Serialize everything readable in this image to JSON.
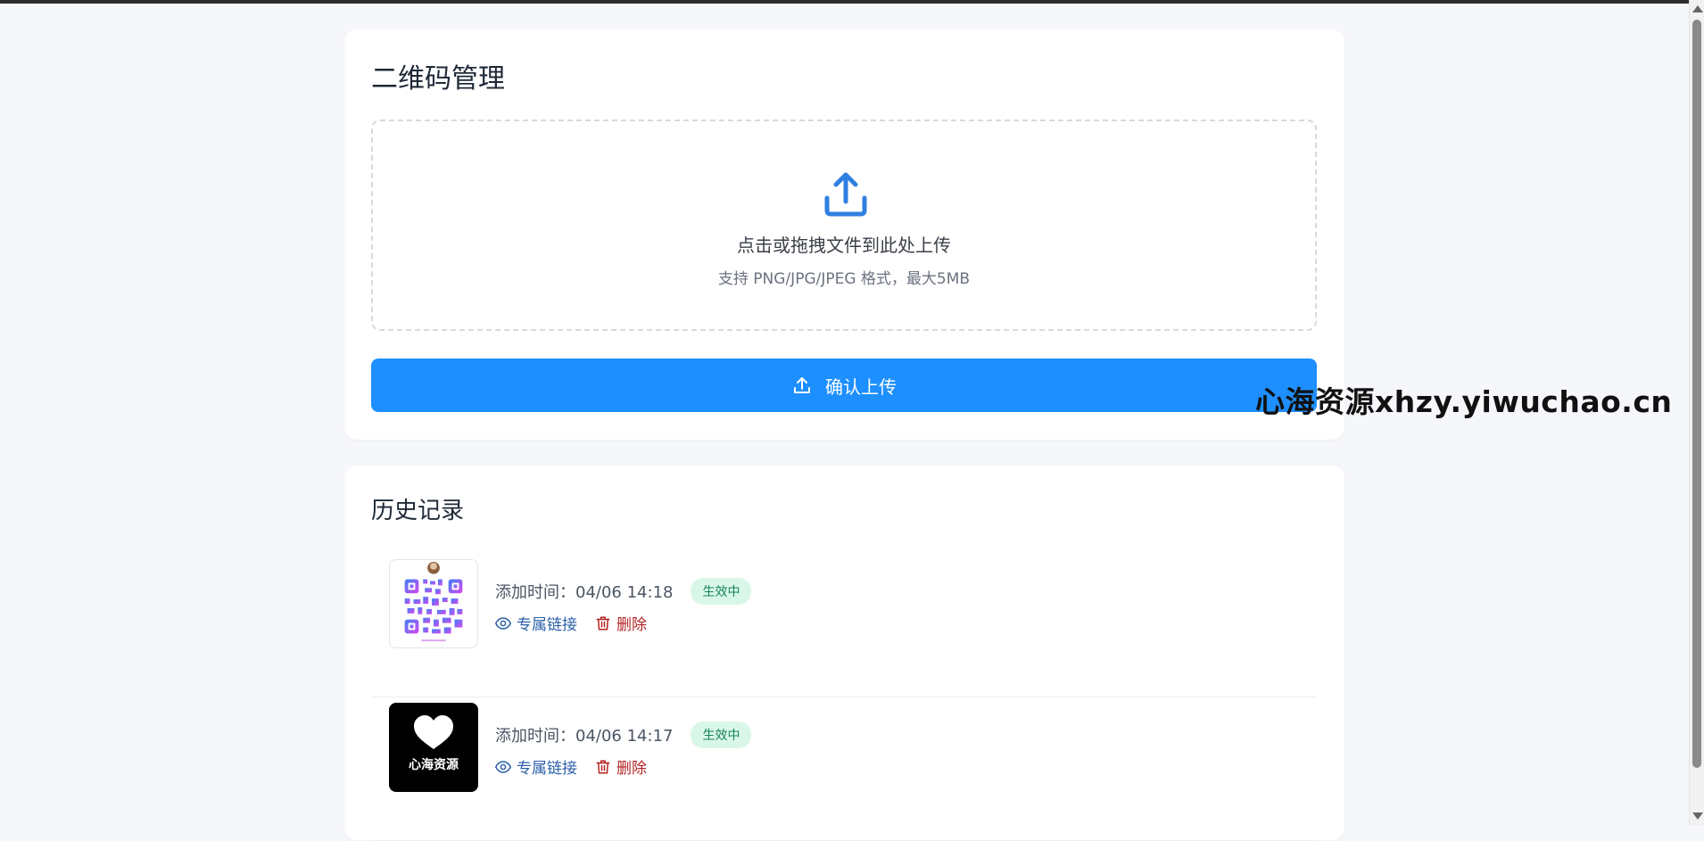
{
  "upload_card": {
    "title": "二维码管理",
    "dropzone_title": "点击或拖拽文件到此处上传",
    "dropzone_hint": "支持 PNG/JPG/JPEG 格式，最大5MB",
    "confirm_label": "确认上传"
  },
  "history": {
    "title": "历史记录",
    "items": [
      {
        "time": "添加时间：04/06 14:18",
        "status": "生效中",
        "link_label": "专属链接",
        "delete_label": "删除",
        "thumb_type": "qr-code"
      },
      {
        "time": "添加时间：04/06 14:17",
        "status": "生效中",
        "link_label": "专属链接",
        "delete_label": "删除",
        "thumb_type": "heart-logo",
        "thumb_caption": "心海资源"
      }
    ]
  },
  "watermark": "心海资源xhzy.yiwuchao.cn",
  "colors": {
    "accent": "#1e8fff",
    "badge_bg": "#d9f7e8",
    "badge_text": "#16845a",
    "link": "#2b5fa8",
    "danger": "#b42323"
  }
}
